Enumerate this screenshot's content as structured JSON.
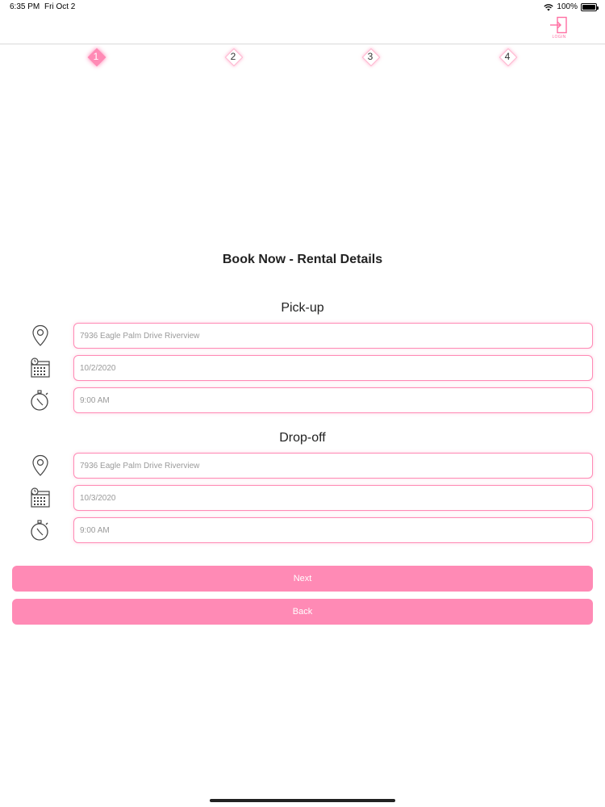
{
  "status_bar": {
    "time": "6:35 PM",
    "date": "Fri Oct 2",
    "battery": "100%"
  },
  "header": {
    "login_label": "LOGIN"
  },
  "stepper": {
    "steps": [
      "1",
      "2",
      "3",
      "4"
    ],
    "active": 1
  },
  "title": "Book Now - Rental Details",
  "pickup": {
    "heading": "Pick-up",
    "location": "7936 Eagle Palm Drive Riverview",
    "date": "10/2/2020",
    "time": "9:00 AM"
  },
  "dropoff": {
    "heading": "Drop-off",
    "location": "7936 Eagle Palm Drive Riverview",
    "date": "10/3/2020",
    "time": "9:00 AM"
  },
  "buttons": {
    "next": "Next",
    "back": "Back"
  },
  "colors": {
    "accent": "#ff8ab5",
    "accent_light": "#ffb6cf"
  },
  "icons": [
    "wifi-icon",
    "battery-icon",
    "login-icon",
    "location-pin-icon",
    "calendar-icon",
    "stopwatch-icon"
  ]
}
